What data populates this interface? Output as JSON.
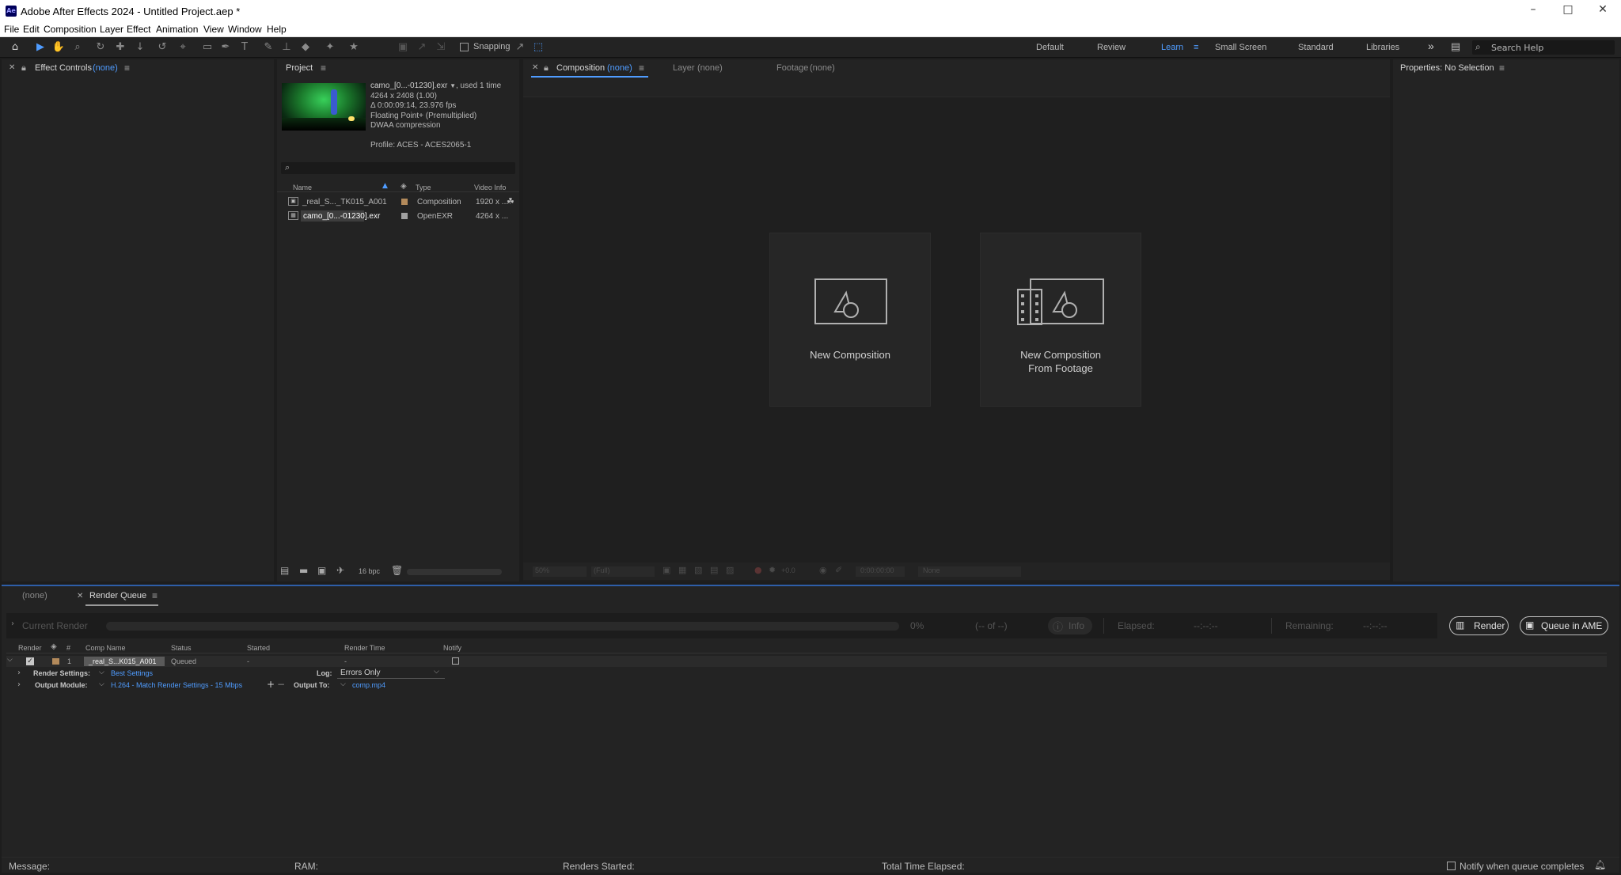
{
  "titlebar": {
    "app_badge": "Ae",
    "title": "Adobe After Effects 2024 - Untitled Project.aep *",
    "minimize_icon": "minimize-icon",
    "maximize_icon": "maximize-icon",
    "close_icon": "close-icon"
  },
  "menu": [
    "File",
    "Edit",
    "Composition",
    "Layer",
    "Effect",
    "Animation",
    "View",
    "Window",
    "Help"
  ],
  "toolbar": {
    "snapping_label": "Snapping",
    "workspaces": [
      "Default",
      "Review",
      "Learn",
      "Small Screen",
      "Standard",
      "Libraries"
    ],
    "active_workspace": "Learn",
    "more": "»",
    "search_placeholder": "Search Help"
  },
  "effect_controls": {
    "title": "Effect Controls",
    "value": "(none)"
  },
  "project": {
    "title": "Project",
    "footage_name": "camo_[0...-01230].exr",
    "used": ", used 1 time",
    "dims": "4264 x 2408 (1.00)",
    "duration": "Δ 0:00:09:14, 23.976 fps",
    "color": "Floating Point+ (Premultiplied)",
    "compression": "DWAA compression",
    "profile": "Profile: ACES - ACES2065-1",
    "columns": {
      "name": "Name",
      "type": "Type",
      "video_info": "Video Info"
    },
    "items": [
      {
        "name": "_real_S..._TK015_A001",
        "type": "Composition",
        "info": "1920 x ...",
        "label_color": "#b38a5b"
      },
      {
        "name": "camo_[0...-01230].exr",
        "type": "OpenEXR",
        "info": "4264 x ...",
        "label_color": "#a0a0a0"
      }
    ],
    "bpc": "16 bpc"
  },
  "composition": {
    "tab_label": "Composition",
    "tab_value": "(none)",
    "layer_label": "Layer",
    "layer_value": "(none)",
    "footage_label": "Footage",
    "footage_value": "(none)",
    "new_comp": "New Composition",
    "new_comp_footage_l1": "New Composition",
    "new_comp_footage_l2": "From Footage",
    "zoom": "50%",
    "resolution": "(Full)",
    "exposure": "+0.0",
    "timecode": "0:00:00:00",
    "view": "None"
  },
  "properties": {
    "title": "Properties: No Selection"
  },
  "render_queue": {
    "tab_none": "(none)",
    "tab_title": "Render Queue",
    "current_render": "Current Render",
    "progress": "0%",
    "of": "(-- of --)",
    "info": "Info",
    "elapsed_label": "Elapsed:",
    "elapsed_value": "--:--:--",
    "remaining_label": "Remaining:",
    "remaining_value": "--:--:--",
    "render_btn": "Render",
    "queue_ame_btn": "Queue in AME",
    "columns": [
      "Render",
      "#",
      "Comp Name",
      "Status",
      "Started",
      "Render Time",
      "Notify"
    ],
    "item": {
      "number": "1",
      "comp_name": "_real_S...K015_A001",
      "status": "Queued",
      "started": "-",
      "render_time": "-"
    },
    "render_settings_label": "Render Settings:",
    "render_settings_value": "Best Settings",
    "log_label": "Log:",
    "log_value": "Errors Only",
    "output_module_label": "Output Module:",
    "output_module_value": "H.264 - Match Render Settings - 15 Mbps",
    "output_to_label": "Output To:",
    "output_to_value": "comp.mp4"
  },
  "status_bar": {
    "message": "Message:",
    "ram": "RAM:",
    "renders_started": "Renders Started:",
    "total_time": "Total Time Elapsed:",
    "notify": "Notify when queue completes"
  }
}
